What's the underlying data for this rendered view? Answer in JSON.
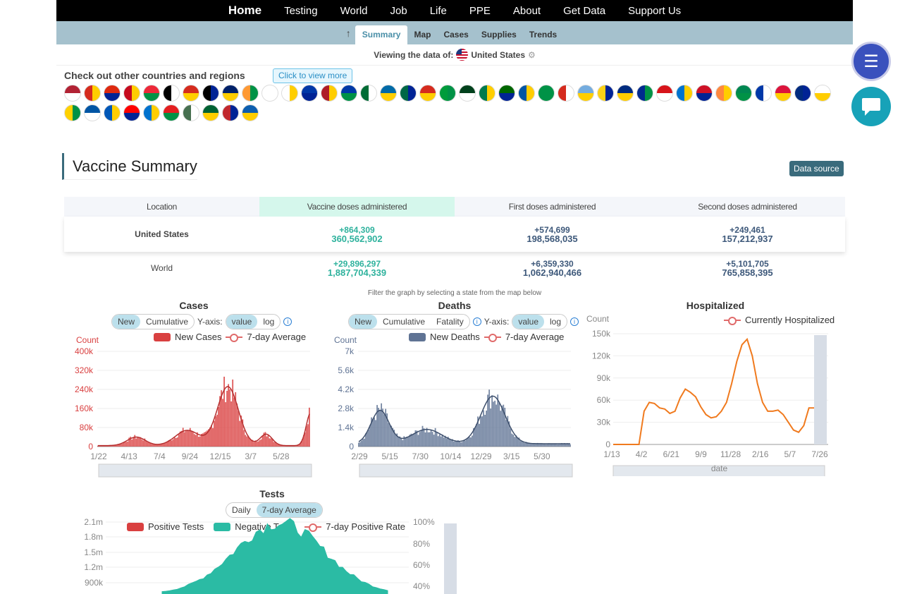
{
  "nav": {
    "items": [
      "Home",
      "Testing",
      "World",
      "Job",
      "Life",
      "PPE",
      "About",
      "Get Data",
      "Support Us"
    ]
  },
  "subnav": {
    "tabs": [
      "Summary",
      "Map",
      "Cases",
      "Supplies",
      "Trends"
    ]
  },
  "viewing": {
    "label": "Viewing the data of:",
    "country": "United States"
  },
  "countries": {
    "title": "Check out other countries and regions",
    "view_more": "Click to view more",
    "flag_colors": [
      "#b22234",
      "#d52b1e",
      "#de2910",
      "#c60b1e",
      "#ed2939",
      "#000000",
      "#d52b1e",
      "#000000",
      "#012169",
      "#ff9933",
      "#ffffff",
      "#ffffff",
      "#0038a8",
      "#ae1c28",
      "#0039a6",
      "#006c35",
      "#006aa7",
      "#006847",
      "#d52b1e",
      "#009c3b",
      "#01411c",
      "#007a4d",
      "#006600",
      "#0055a4",
      "#009246",
      "#d52b1e",
      "#74acdf",
      "#fcd116",
      "#002b7f",
      "#002a8f",
      "#d7141a",
      "#0073cf",
      "#ce1126",
      "#ff883e",
      "#008751",
      "#0038a8",
      "#dc143c",
      "#002b7f",
      "#ffffff",
      "#ffd100",
      "#0055a4",
      "#0057b7",
      "#ff0000",
      "#0072ce",
      "#e41e20",
      "#477050",
      "#006233",
      "#c1272d",
      "#0d5eaf"
    ]
  },
  "buttons": {
    "menu_icon": "menu-icon",
    "chat_icon": "chat-icon"
  },
  "vaccine": {
    "title": "Vaccine Summary",
    "data_source": "Data source",
    "headers": [
      "Location",
      "Vaccine doses administered",
      "First doses administered",
      "Second doses administered"
    ],
    "rows": [
      {
        "location": "United States",
        "doses_inc": "+864,309",
        "doses": "360,562,902",
        "first_inc": "+574,699",
        "first": "198,568,035",
        "second_inc": "+249,461",
        "second": "157,212,937"
      },
      {
        "location": "World",
        "doses_inc": "+29,896,297",
        "doses": "1,887,704,339",
        "first_inc": "+6,359,330",
        "first": "1,062,940,466",
        "second_inc": "+5,101,705",
        "second": "765,858,395"
      }
    ]
  },
  "filter_note": "Filter the graph by selecting a state from the map below",
  "cases_chart": {
    "title": "Cases",
    "toggle": [
      "New",
      "Cumulative"
    ],
    "yaxis_label": "Y-axis:",
    "yaxis_options": [
      "value",
      "log"
    ],
    "legend": [
      "New Cases",
      "7-day Average"
    ],
    "count_label": "Count",
    "y_ticks": [
      "400k",
      "320k",
      "240k",
      "160k",
      "80k",
      "0"
    ],
    "x_ticks": [
      "1/22",
      "4/13",
      "7/4",
      "9/24",
      "12/15",
      "3/7",
      "5/28"
    ],
    "color": "#d94040"
  },
  "deaths_chart": {
    "title": "Deaths",
    "toggle": [
      "New",
      "Cumulative",
      "Fatality"
    ],
    "yaxis_label": "Y-axis:",
    "yaxis_options": [
      "value",
      "log"
    ],
    "legend": [
      "New Deaths",
      "7-day Average"
    ],
    "count_label": "Count",
    "y_ticks": [
      "7k",
      "5.6k",
      "4.2k",
      "2.8k",
      "1.4k",
      "0"
    ],
    "x_ticks": [
      "2/29",
      "5/15",
      "7/30",
      "10/14",
      "12/29",
      "3/15",
      "5/30"
    ],
    "color": "#5f7394"
  },
  "hosp_chart": {
    "title": "Hospitalized",
    "legend": [
      "Currently Hospitalized"
    ],
    "count_label": "Count",
    "y_ticks": [
      "150k",
      "120k",
      "90k",
      "60k",
      "30k",
      "0"
    ],
    "x_ticks": [
      "1/13",
      "4/2",
      "6/21",
      "9/9",
      "11/28",
      "2/16",
      "5/7",
      "7/26"
    ],
    "x_label": "date",
    "color": "#f07a1e"
  },
  "tests_chart": {
    "title": "Tests",
    "toggle": [
      "Daily",
      "7-day Average"
    ],
    "legend": [
      "Positive Tests",
      "Negative Tests",
      "7-day Positive Rate"
    ],
    "y_ticks": [
      "2.1m",
      "1.8m",
      "1.5m",
      "1.2m",
      "900k"
    ],
    "y2_ticks": [
      "100%",
      "80%",
      "60%",
      "40%"
    ],
    "pos_color": "#d94040",
    "neg_color": "#2bbba4"
  }
}
